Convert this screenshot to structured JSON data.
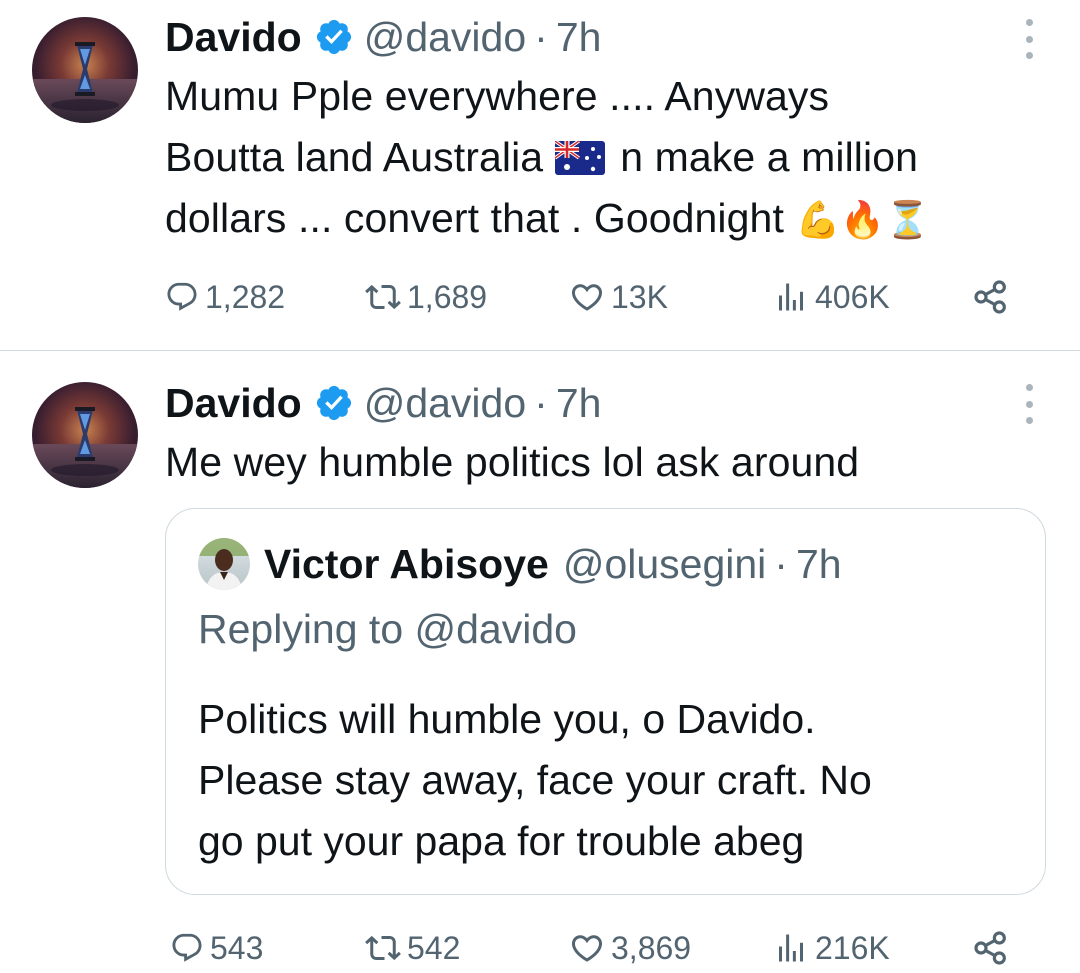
{
  "tweets": [
    {
      "author_name": "Davido",
      "handle": "@davido",
      "separator": "·",
      "time": "7h",
      "text_line1": "Mumu Pple everywhere .... Anyways",
      "text_line2a": "Boutta land Australia",
      "text_line2b": "n make a million",
      "text_line3": "dollars ... convert that . Goodnight",
      "emoji_flag": "🇦🇺",
      "emoji_muscle": "💪",
      "emoji_fire": "🔥",
      "emoji_hourglass": "⏳",
      "replies": "1,282",
      "retweets": "1,689",
      "likes": "13K",
      "views": "406K"
    },
    {
      "author_name": "Davido",
      "handle": "@davido",
      "separator": "·",
      "time": "7h",
      "text": "Me wey humble politics lol ask around",
      "quote": {
        "author_name": "Victor Abisoye",
        "handle": "@olusegini",
        "separator": "·",
        "time": "7h",
        "replying_to": "Replying to @davido",
        "text_line1": "Politics will humble you, o Davido.",
        "text_line2": "Please stay away, face your craft. No",
        "text_line3": "go put your papa for trouble abeg"
      },
      "replies": "543",
      "retweets": "542",
      "likes": "3,869",
      "views": "216K"
    }
  ],
  "icons": {
    "verified": "verified-badge-icon",
    "more": "more-vertical-icon",
    "reply": "reply-icon",
    "retweet": "retweet-icon",
    "like": "heart-icon",
    "views": "views-icon",
    "share": "share-icon"
  },
  "colors": {
    "verified_blue": "#1d9bf0",
    "secondary_text": "#536471",
    "primary_text": "#0f1419",
    "border": "#cfd9de"
  }
}
